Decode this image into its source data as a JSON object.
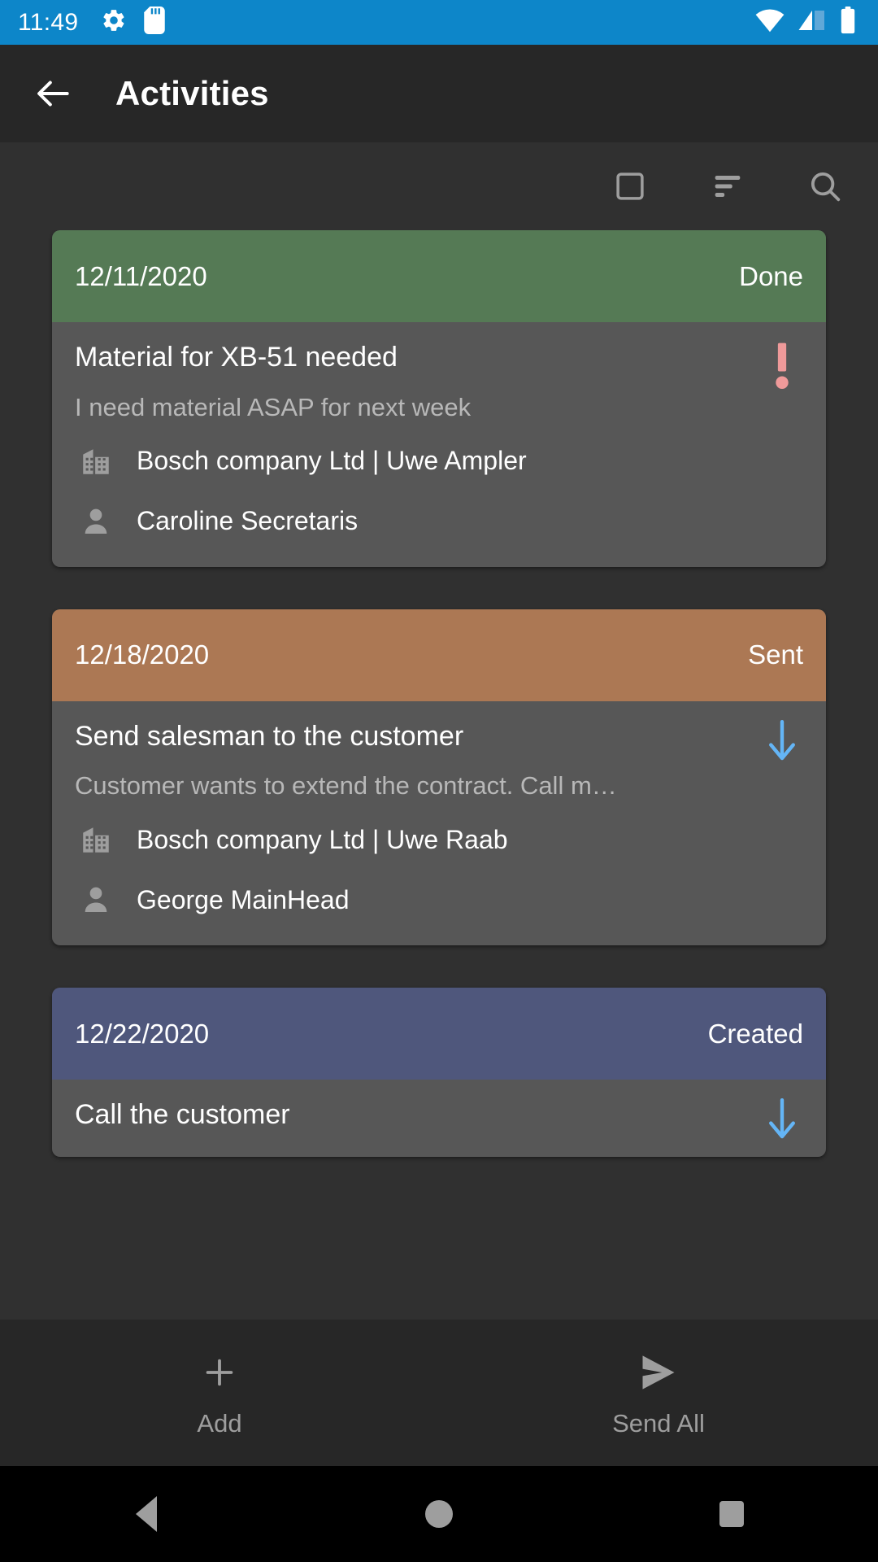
{
  "statusbar": {
    "time": "11:49",
    "left_icons": [
      "gear-icon",
      "sd-card-icon"
    ],
    "right_icons": [
      "wifi-icon",
      "cellular-signal-icon",
      "battery-icon"
    ],
    "background_color": "#0d86c9"
  },
  "appbar": {
    "back_icon": "arrow-left-icon",
    "title": "Activities",
    "background_color": "#272727"
  },
  "action_row": {
    "items": [
      {
        "name": "select-all-checkbox",
        "icon": "square-outline-icon"
      },
      {
        "name": "sort-button",
        "icon": "sort-lines-icon"
      },
      {
        "name": "search-button",
        "icon": "search-icon"
      }
    ]
  },
  "colors": {
    "page_background": "#303030",
    "card_body": "#575757",
    "status_done": "#557a55",
    "status_sent": "#ac7854",
    "status_created": "#4f577c",
    "priority_high": "#ef9a9a",
    "download_arrow": "#64b5f6",
    "muted_text": "#b8b8b8"
  },
  "cards": [
    {
      "date": "12/11/2020",
      "status": "Done",
      "status_color": "#557a55",
      "title": "Material for XB-51 needed",
      "subtitle": "I need material ASAP for next week",
      "company": "Bosch company Ltd | Uwe Ampler",
      "contact": "Caroline Secretaris",
      "trailing_icon": "priority-exclamation-icon"
    },
    {
      "date": "12/18/2020",
      "status": "Sent",
      "status_color": "#ac7854",
      "title": "Send salesman to the customer",
      "subtitle": "Customer wants to extend the contract. Call m…",
      "company": "Bosch company Ltd | Uwe Raab",
      "contact": "George MainHead",
      "trailing_icon": "arrow-down-icon"
    },
    {
      "date": "12/22/2020",
      "status": "Created",
      "status_color": "#4f577c",
      "title": "Call the customer",
      "subtitle": "",
      "company": "",
      "contact": "",
      "trailing_icon": "arrow-down-icon"
    }
  ],
  "bottombar": {
    "items": [
      {
        "name": "add-button",
        "icon": "plus-icon",
        "label": "Add"
      },
      {
        "name": "send-all-button",
        "icon": "send-icon",
        "label": "Send All"
      }
    ]
  },
  "navbar": {
    "items": [
      {
        "name": "nav-back-button",
        "icon": "triangle-back-icon"
      },
      {
        "name": "nav-home-button",
        "icon": "circle-home-icon"
      },
      {
        "name": "nav-recents-button",
        "icon": "square-recents-icon"
      }
    ]
  }
}
